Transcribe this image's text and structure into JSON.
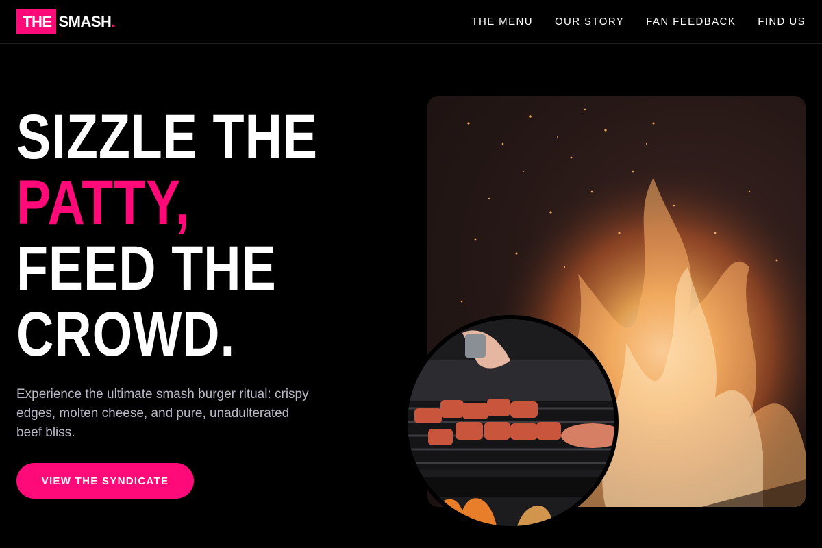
{
  "brand": {
    "logo_box": "THE",
    "logo_word": "SMASH",
    "logo_dot": ".",
    "accent_color": "#ff0a78"
  },
  "nav": {
    "items": [
      {
        "label": "THE MENU"
      },
      {
        "label": "OUR STORY"
      },
      {
        "label": "FAN FEEDBACK"
      },
      {
        "label": "FIND US"
      }
    ]
  },
  "hero": {
    "headline": {
      "line1": "SIZZLE THE",
      "line2": "PATTY,",
      "line3": "FEED THE",
      "line4": "CROWD."
    },
    "lead": "Experience the ultimate smash burger ritual: crispy edges, molten cheese, and pure, unadulterated beef bliss.",
    "cta_label": "VIEW THE SYNDICATE"
  },
  "images": {
    "fire_icon": "flame-photo",
    "grill_icon": "grill-skewers-photo"
  }
}
